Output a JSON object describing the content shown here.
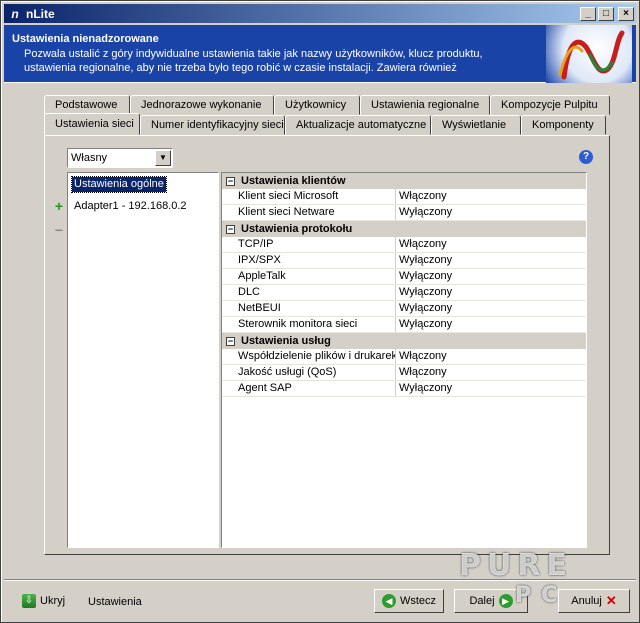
{
  "window": {
    "title": "nLite",
    "app_icon": "n"
  },
  "header": {
    "title": "Ustawienia nienadzorowane",
    "description": "Pozwala ustalić z góry indywidualne ustawienia takie jak nazwy użytkowników, klucz produktu, ustawienia regionalne, aby nie trzeba było tego robić w czasie instalacji. Zawiera również"
  },
  "tabs": {
    "row1": [
      "Podstawowe",
      "Jednorazowe wykonanie",
      "Użytkownicy",
      "Ustawienia regionalne",
      "Kompozycje Pulpitu"
    ],
    "row2": [
      "Ustawienia sieci",
      "Numer identyfikacyjny sieci",
      "Aktualizacje automatyczne",
      "Wyświetlanie",
      "Komponenty"
    ],
    "active": "Ustawienia sieci"
  },
  "panel": {
    "mode_select": "Własny",
    "help": "?",
    "list": [
      "Ustawienia ogólne",
      "Adapter1 - 192.168.0.2"
    ],
    "add_symbol": "+",
    "remove_symbol": "−"
  },
  "grid": {
    "categories": [
      {
        "label": "Ustawienia klientów",
        "props": [
          {
            "name": "Klient sieci Microsoft",
            "value": "Włączony"
          },
          {
            "name": "Klient sieci Netware",
            "value": "Wyłączony"
          }
        ]
      },
      {
        "label": "Ustawienia protokołu",
        "props": [
          {
            "name": "TCP/IP",
            "value": "Włączony"
          },
          {
            "name": "IPX/SPX",
            "value": "Wyłączony"
          },
          {
            "name": "AppleTalk",
            "value": "Wyłączony"
          },
          {
            "name": "DLC",
            "value": "Wyłączony"
          },
          {
            "name": "NetBEUI",
            "value": "Wyłączony"
          },
          {
            "name": "Sterownik monitora sieci",
            "value": "Wyłączony"
          }
        ]
      },
      {
        "label": "Ustawienia usług",
        "props": [
          {
            "name": "Współdzielenie plików i drukarek",
            "value": "Włączony"
          },
          {
            "name": "Jakość usługi (QoS)",
            "value": "Włączony"
          },
          {
            "name": "Agent SAP",
            "value": "Wyłączony"
          }
        ]
      }
    ],
    "toggle_symbol": "−"
  },
  "bottom": {
    "hide_label": "Ukryj",
    "status": "Ustawienia",
    "back_label": "Wstecz",
    "next_label": "Dalej",
    "cancel_label": "Anuluj"
  },
  "watermark": {
    "line1": "PURE",
    "line2": "PC"
  }
}
